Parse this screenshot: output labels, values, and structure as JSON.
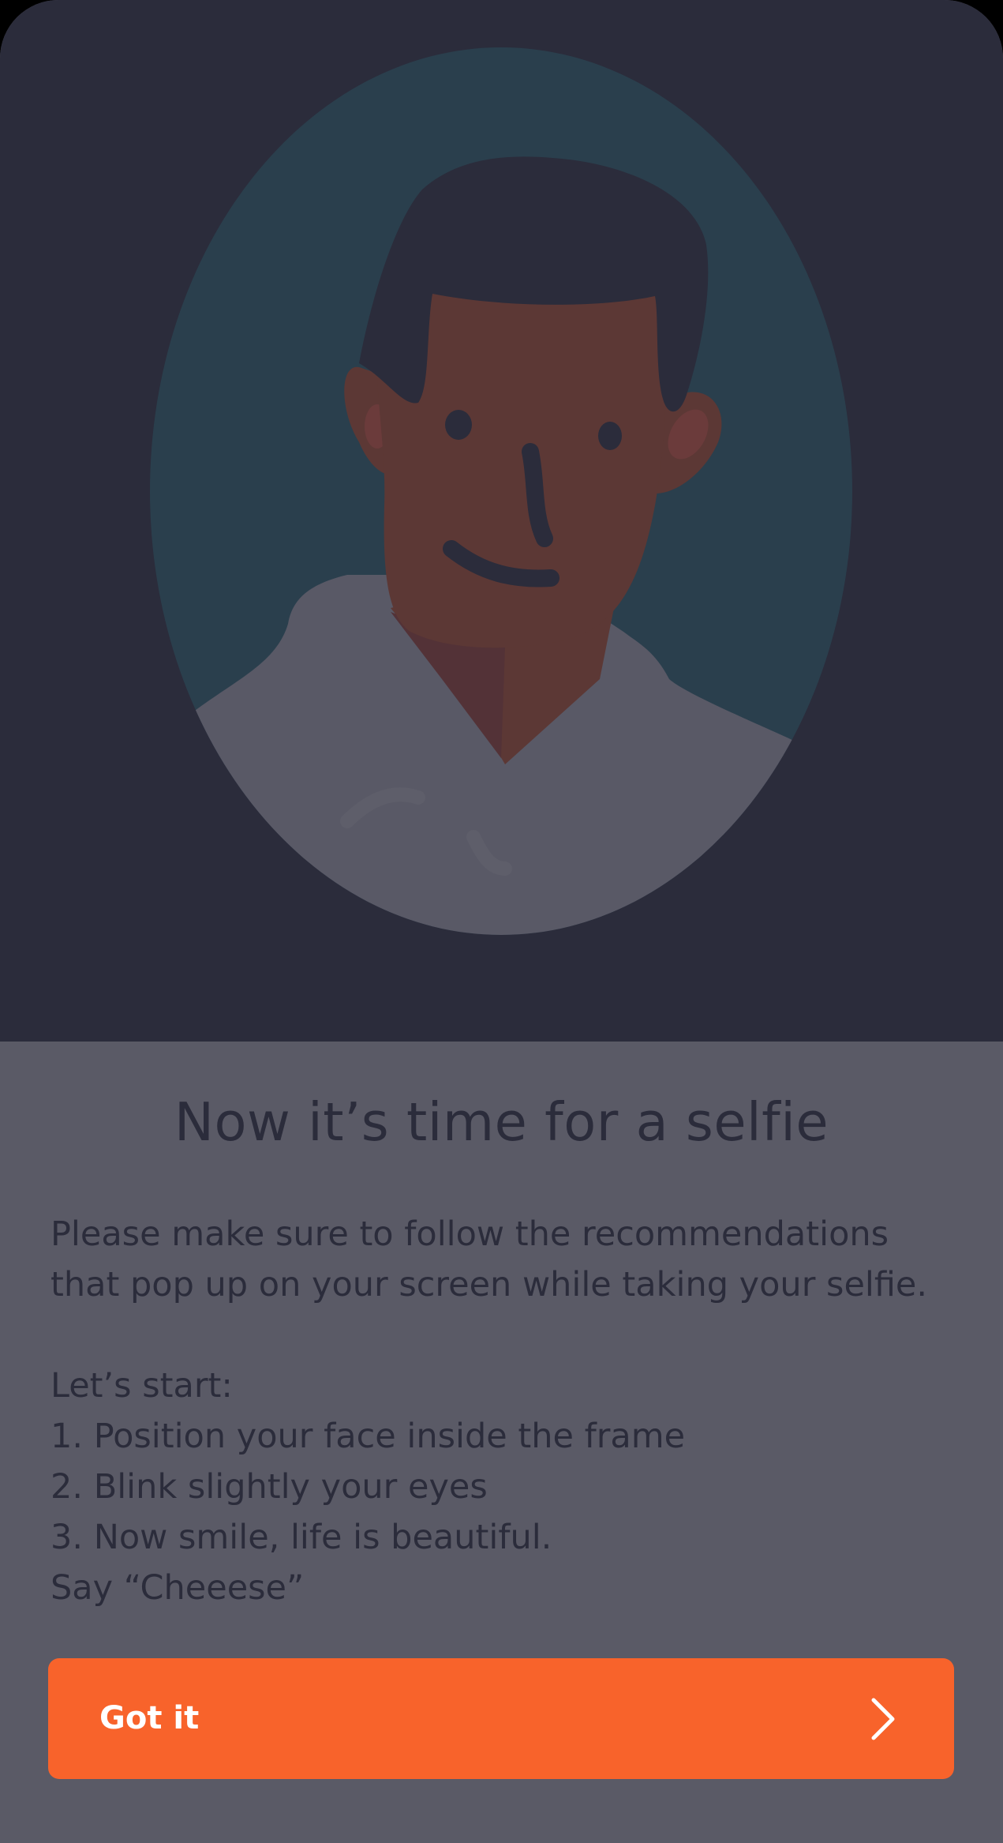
{
  "colors": {
    "hero_background": "#2b2c3b",
    "content_background": "#5a5a66",
    "text": "#2b2c3b",
    "accent": "#f8632b",
    "button_text": "#ffffff"
  },
  "illustration": {
    "subject": "man portrait in oval frame",
    "icon": "selfie-illustration"
  },
  "content": {
    "title": "Now it’s time for a selfie",
    "intro_line1": "Please make sure to follow the recommendations",
    "intro_line2": "that pop up on your screen while taking your selfie.",
    "steps_header": "Let’s start:",
    "steps": [
      "1. Position your face inside the frame",
      "2. Blink slightly your eyes",
      "3. Now smile, life is beautiful.",
      "Say “Cheeese”"
    ]
  },
  "button": {
    "label": "Got it",
    "icon": "chevron-right-icon"
  }
}
